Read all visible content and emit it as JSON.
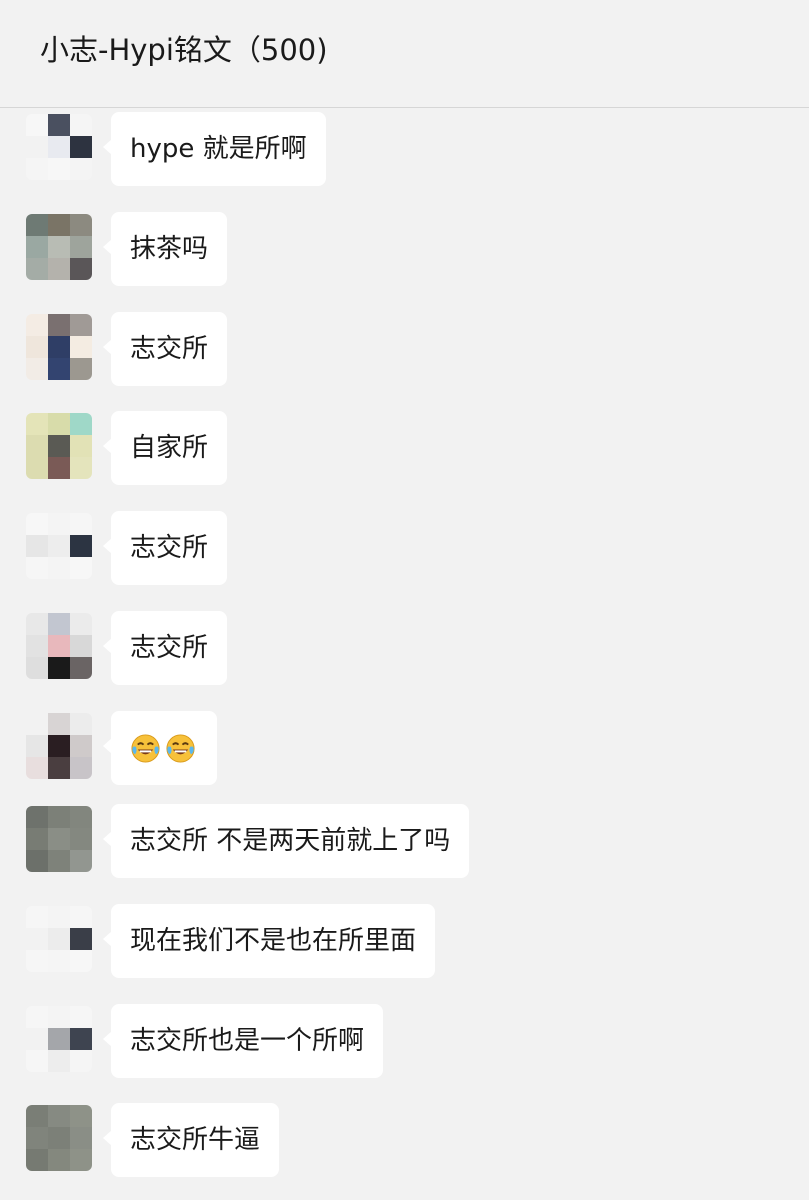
{
  "chat": {
    "title": "小志-Hypi铭文（500)"
  },
  "messages": [
    {
      "text": "hype 就是所啊",
      "avatar_colors": [
        "#f7f7f7",
        "#4a5060",
        "#f5f5f5",
        "#f2f2f2",
        "#e8eaf0",
        "#2d3340",
        "#f5f5f5",
        "#f7f7f7",
        "#f4f4f4"
      ]
    },
    {
      "text": "抹茶吗",
      "avatar_colors": [
        "#6e7a74",
        "#7a7466",
        "#8c8a80",
        "#9aa8a2",
        "#b8bcb4",
        "#9ea49c",
        "#a4aca6",
        "#b4b2ac",
        "#5a5658"
      ]
    },
    {
      "text": "志交所",
      "avatar_colors": [
        "#f4ece4",
        "#7a7070",
        "#a09a96",
        "#efe6dc",
        "#2f3e66",
        "#f4ece2",
        "#f2ece6",
        "#334470",
        "#9c9890"
      ]
    },
    {
      "text": "自家所",
      "avatar_colors": [
        "#e4e4b8",
        "#d8dcaa",
        "#9fd8c8",
        "#dcdcb0",
        "#5a5a54",
        "#e2e2b6",
        "#dcdcb0",
        "#7a5a56",
        "#e4e4bc"
      ]
    },
    {
      "text": "志交所",
      "avatar_colors": [
        "#f7f7f7",
        "#f4f4f4",
        "#f6f6f6",
        "#e6e6e6",
        "#ededed",
        "#2c3442",
        "#f6f6f6",
        "#f4f4f4",
        "#f7f7f7"
      ]
    },
    {
      "text": "志交所",
      "avatar_colors": [
        "#e8e8e8",
        "#c2c6d0",
        "#ebebeb",
        "#e2e2e2",
        "#e8b8bc",
        "#d8d8d8",
        "#dedede",
        "#1a1a1a",
        "#6a6464"
      ]
    },
    {
      "text": "",
      "emoji": true,
      "avatar_colors": [
        "#f2f2f2",
        "#d8d4d4",
        "#ececec",
        "#e6e6e6",
        "#2a1e22",
        "#cfcaca",
        "#e8dede",
        "#4a3e40",
        "#c8c4c8"
      ]
    },
    {
      "text": "志交所 不是两天前就上了吗",
      "avatar_colors": [
        "#6e726c",
        "#7c8078",
        "#82867e",
        "#787c74",
        "#8a8e86",
        "#848880",
        "#6c706a",
        "#7e827a",
        "#929690"
      ]
    },
    {
      "text": "现在我们不是也在所里面",
      "avatar_colors": [
        "#f6f6f6",
        "#f4f4f4",
        "#f6f6f6",
        "#f2f2f2",
        "#ececec",
        "#3a3e48",
        "#f6f6f6",
        "#f5f5f5",
        "#f7f7f7"
      ]
    },
    {
      "text": "志交所也是一个所啊",
      "avatar_colors": [
        "#f6f6f6",
        "#f4f4f4",
        "#f6f6f6",
        "#f2f2f2",
        "#a4a6aa",
        "#3e4450",
        "#f6f6f6",
        "#ededed",
        "#f5f5f5"
      ]
    },
    {
      "text": "志交所牛逼",
      "avatar_colors": [
        "#7a7e76",
        "#868a82",
        "#8e9288",
        "#80847c",
        "#7c8078",
        "#8a8e86",
        "#767a72",
        "#84887e",
        "#8e9288"
      ]
    }
  ],
  "emoji_names": [
    "tears-of-joy-emoji",
    "tears-of-joy-emoji"
  ],
  "colors": {
    "background": "#f2f2f2",
    "bubble": "#ffffff",
    "text": "#1a1a1a"
  }
}
